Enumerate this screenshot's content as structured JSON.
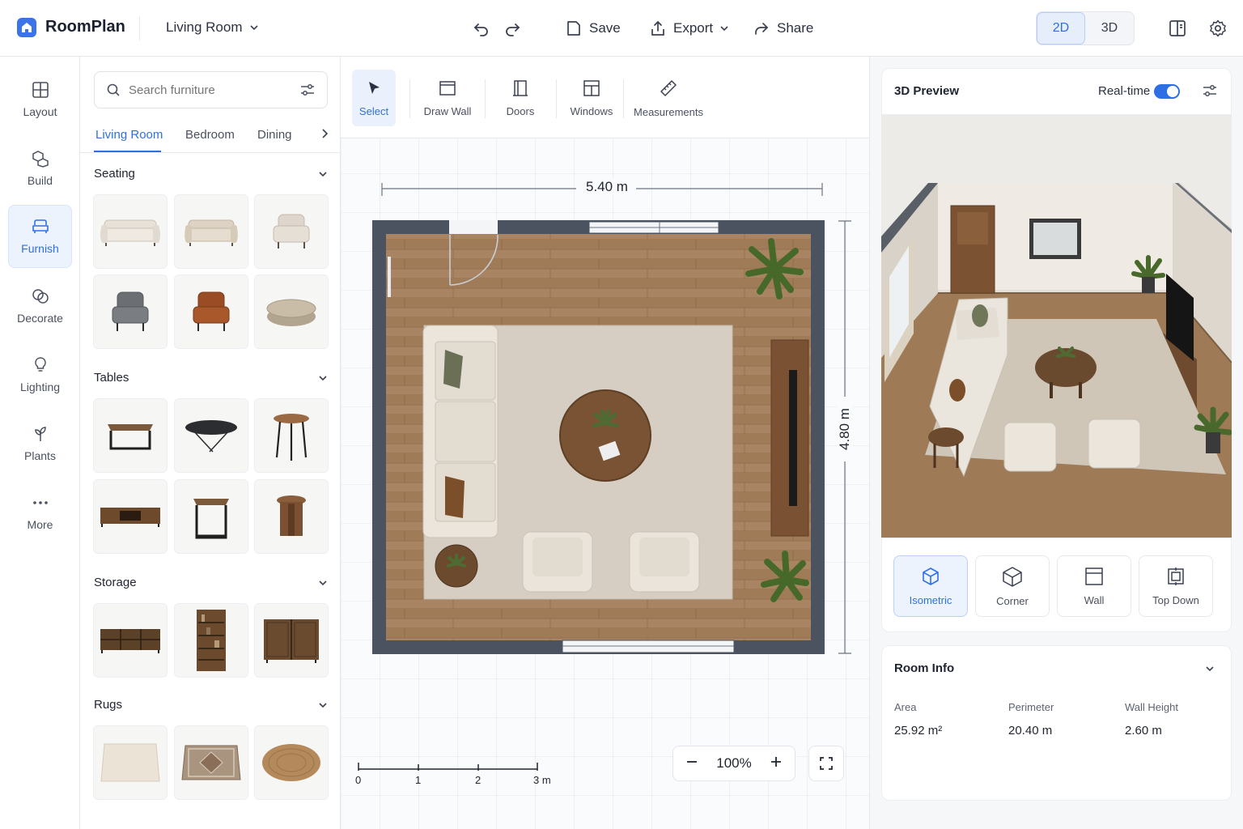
{
  "app": {
    "title": "RoomPlan",
    "room": "Living Room"
  },
  "header": {
    "save": "Save",
    "export": "Export",
    "share": "Share",
    "view_modes": [
      "2D",
      "3D"
    ],
    "active_view": "2D"
  },
  "rail": {
    "items": [
      {
        "label": "Layout",
        "icon": "layout-grid-icon"
      },
      {
        "label": "Build",
        "icon": "cubes-icon"
      },
      {
        "label": "Furnish",
        "icon": "sofa-icon"
      },
      {
        "label": "Decorate",
        "icon": "palette-icon"
      },
      {
        "label": "Lighting",
        "icon": "lightbulb-icon"
      },
      {
        "label": "Plants",
        "icon": "plant-icon"
      },
      {
        "label": "More",
        "icon": "more-dots-icon"
      }
    ],
    "active": "Furnish"
  },
  "catalog": {
    "search_placeholder": "Search furniture",
    "tabs": [
      "Living Room",
      "Bedroom",
      "Dining"
    ],
    "active_tab": "Living Room",
    "categories": [
      {
        "name": "Seating",
        "items": [
          "3-seat sofa",
          "loveseat",
          "armchair",
          "grey armchair",
          "leather armchair",
          "pouf"
        ]
      },
      {
        "name": "Tables",
        "items": [
          "coffee table",
          "oval coffee table",
          "round side table",
          "tv console",
          "square side table",
          "stool"
        ]
      },
      {
        "name": "Storage",
        "items": [
          "sideboard",
          "bookshelf",
          "cabinet"
        ]
      },
      {
        "name": "Rugs",
        "items": [
          "cream rug",
          "patterned rug",
          "round jute rug"
        ]
      }
    ]
  },
  "tools": {
    "items": [
      {
        "label": "Select",
        "icon": "cursor-icon"
      },
      {
        "label": "Draw Wall",
        "icon": "wall-icon"
      },
      {
        "label": "Doors",
        "icon": "door-icon"
      },
      {
        "label": "Windows",
        "icon": "window-icon"
      },
      {
        "label": "Measurements",
        "icon": "ruler-icon"
      }
    ],
    "active": "Select"
  },
  "plan": {
    "width_label": "5.40 m",
    "height_label": "4.80 m",
    "zoom": "100%",
    "scale_ticks": [
      "0",
      "1",
      "2",
      "3 m"
    ]
  },
  "preview": {
    "title": "3D Preview",
    "realtime_label": "Real-time",
    "realtime_on": true,
    "camera_views": [
      {
        "label": "Isometric",
        "icon": "cube-icon"
      },
      {
        "label": "Corner",
        "icon": "corner-box-icon"
      },
      {
        "label": "Wall",
        "icon": "wall-view-icon"
      },
      {
        "label": "Top Down",
        "icon": "top-down-icon"
      }
    ],
    "active_view": "Isometric"
  },
  "room_info": {
    "title": "Room Info",
    "area_label": "Area",
    "area_value": "25.92 m²",
    "perimeter_label": "Perimeter",
    "perimeter_value": "20.40 m",
    "wall_height_label": "Wall Height",
    "wall_height_value": "2.60 m"
  },
  "colors": {
    "accent": "#2f6fe4",
    "wall": "#4b5260",
    "floor": "#a78360",
    "rug": "#d8cfc2"
  }
}
